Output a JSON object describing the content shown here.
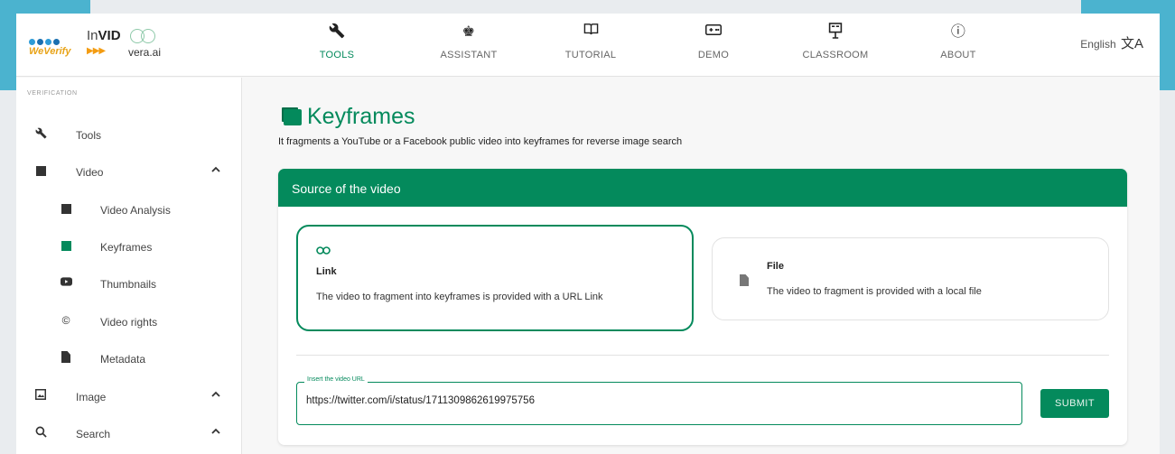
{
  "logo": {
    "weverify": "WeVerify",
    "invid_prefix": "In",
    "invid_bold": "VID",
    "veraai": "vera.ai"
  },
  "nav": {
    "items": [
      {
        "label": "TOOLS",
        "icon": "wrench-icon",
        "glyph": "🔧"
      },
      {
        "label": "ASSISTANT",
        "icon": "robot-icon",
        "glyph": "♚"
      },
      {
        "label": "TUTORIAL",
        "icon": "book-icon",
        "glyph": "📖"
      },
      {
        "label": "DEMO",
        "icon": "gamepad-icon",
        "glyph": "⊡"
      },
      {
        "label": "CLASSROOM",
        "icon": "classroom-icon",
        "glyph": "▦"
      },
      {
        "label": "ABOUT",
        "icon": "info-icon",
        "glyph": "ⓘ"
      }
    ],
    "active": "TOOLS"
  },
  "language": {
    "label": "English",
    "icon": "translate-icon",
    "glyph": "文A"
  },
  "sidebar": {
    "section_label": "VERIFICATION",
    "items": [
      {
        "label": "Tools",
        "icon": "wrench-icon"
      },
      {
        "label": "Video",
        "icon": "video-icon"
      },
      {
        "label": "Video Analysis",
        "icon": "video-analysis-icon"
      },
      {
        "label": "Keyframes",
        "icon": "keyframes-icon"
      },
      {
        "label": "Thumbnails",
        "icon": "youtube-icon"
      },
      {
        "label": "Video rights",
        "icon": "copyright-icon",
        "glyph": "©"
      },
      {
        "label": "Metadata",
        "icon": "file-icon"
      },
      {
        "label": "Image",
        "icon": "image-icon"
      },
      {
        "label": "Search",
        "icon": "search-icon"
      }
    ]
  },
  "page": {
    "title": "Keyframes",
    "subtitle": "It fragments a YouTube or a Facebook public video into keyframes for reverse image search"
  },
  "source_card": {
    "header": "Source of the video",
    "link_option": {
      "title": "Link",
      "description": "The video to fragment into keyframes is provided with a URL Link",
      "icon": "link-icon"
    },
    "file_option": {
      "title": "File",
      "description": "The video to fragment is provided with a local file",
      "icon": "file-icon"
    },
    "url_input": {
      "label": "Insert the video URL",
      "value": "https://twitter.com/i/status/1711309862619975756"
    },
    "submit_label": "SUBMIT"
  },
  "colors": {
    "accent": "#048a5c",
    "corner": "#4bb3cf"
  }
}
